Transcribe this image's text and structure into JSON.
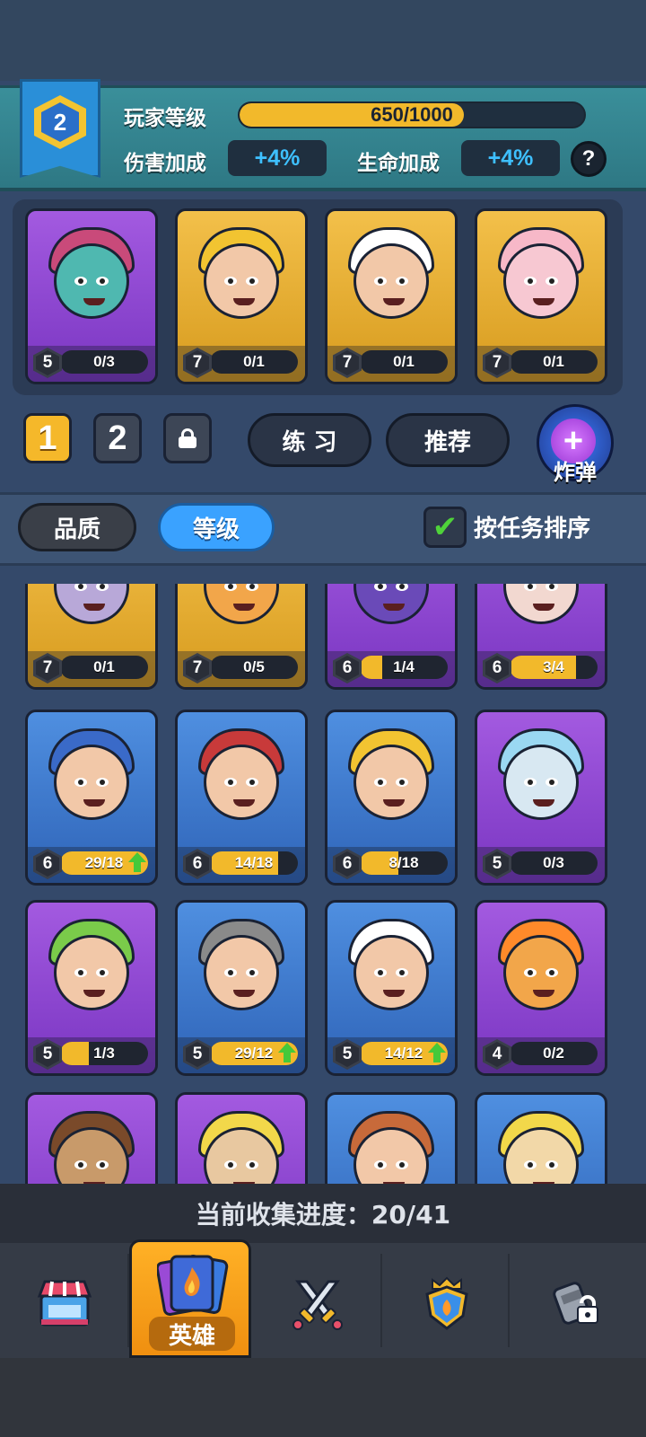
{
  "player": {
    "level": "2",
    "level_label": "玩家等级",
    "xp_text": "650/1000",
    "xp_progress": 0.65,
    "damage_label": "伤害加成",
    "damage_value": "+4%",
    "health_label": "生命加成",
    "health_value": "+4%",
    "help_label": "?"
  },
  "deck": {
    "cards": [
      {
        "level": "5",
        "progress": "0/3",
        "fill": 0,
        "rarity": "purple"
      },
      {
        "level": "7",
        "progress": "0/1",
        "fill": 0,
        "rarity": "gold"
      },
      {
        "level": "7",
        "progress": "0/1",
        "fill": 0,
        "rarity": "gold"
      },
      {
        "level": "7",
        "progress": "0/1",
        "fill": 0,
        "rarity": "gold"
      }
    ],
    "tab1_label": "1",
    "tab2_label": "2",
    "practice_label": "练 习",
    "recommend_label": "推荐",
    "bomb_label": "炸弹",
    "bomb_symbol": "+"
  },
  "filters": {
    "quality_label": "品质",
    "level_label": "等级",
    "sort_label": "按任务排序",
    "sort_checked": true,
    "check_symbol": "✔"
  },
  "collection": [
    {
      "level": "7",
      "progress": "0/1",
      "fill": 0,
      "rarity": "gold",
      "up": false
    },
    {
      "level": "7",
      "progress": "0/5",
      "fill": 0,
      "rarity": "gold",
      "up": false
    },
    {
      "level": "6",
      "progress": "1/4",
      "fill": 0.25,
      "rarity": "purple",
      "up": false
    },
    {
      "level": "6",
      "progress": "3/4",
      "fill": 0.75,
      "rarity": "purple",
      "up": false
    },
    {
      "level": "6",
      "progress": "29/18",
      "fill": 1,
      "rarity": "blue",
      "up": true
    },
    {
      "level": "6",
      "progress": "14/18",
      "fill": 0.78,
      "rarity": "blue",
      "up": false
    },
    {
      "level": "6",
      "progress": "8/18",
      "fill": 0.44,
      "rarity": "blue",
      "up": false
    },
    {
      "level": "5",
      "progress": "0/3",
      "fill": 0,
      "rarity": "purple",
      "up": false
    },
    {
      "level": "5",
      "progress": "1/3",
      "fill": 0.33,
      "rarity": "purple",
      "up": false
    },
    {
      "level": "5",
      "progress": "29/12",
      "fill": 1,
      "rarity": "blue",
      "up": true
    },
    {
      "level": "5",
      "progress": "14/12",
      "fill": 1,
      "rarity": "blue",
      "up": true
    },
    {
      "level": "4",
      "progress": "0/2",
      "fill": 0,
      "rarity": "purple",
      "up": false
    },
    {
      "rarity": "purple"
    },
    {
      "rarity": "purple"
    },
    {
      "rarity": "blue"
    },
    {
      "rarity": "blue"
    }
  ],
  "collection_progress": "当前收集进度：20/41",
  "nav": {
    "shop_icon": "shop-icon",
    "heroes_label": "英雄",
    "battle_icon": "crossed-swords-icon",
    "clan_icon": "shield-icon",
    "locked_icon": "locked-icon"
  },
  "colors": {
    "purple": "#8a44d0",
    "gold": "#e6ae2e",
    "blue": "#3f7bd0",
    "accent_blue": "#3aa2ff",
    "progress_yellow": "#f2b92b"
  }
}
